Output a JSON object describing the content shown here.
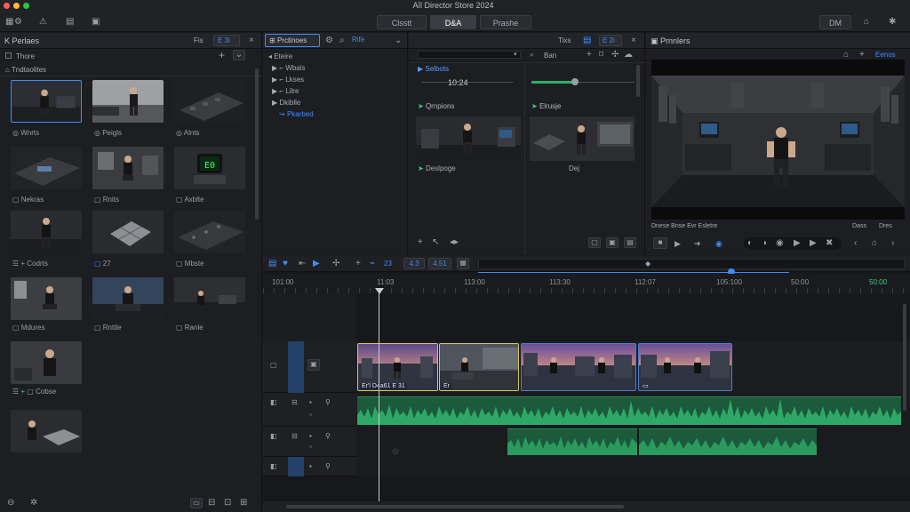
{
  "app": {
    "title": "Aīl Director Store 2024"
  },
  "window_controls": {
    "close_color": "#ff5f57",
    "min_color": "#febc2e",
    "max_color": "#28c840"
  },
  "mode_tabs": [
    {
      "label": "Clsstt"
    },
    {
      "label": "D&A"
    },
    {
      "label": "Prashe"
    }
  ],
  "topbar_right": {
    "button_label": "DM"
  },
  "media_panel": {
    "title": "K Perlaes",
    "header_right": "Fis",
    "header_field": "E 3i",
    "filter_label": "Thore",
    "section_label": "Tndtaolites",
    "thumb_labels": [
      "Wnrts",
      "Peigls",
      "Alnts",
      "Nekras",
      "Rnits",
      "Axblte",
      "Codrts",
      "27",
      "Mbste",
      "Mdures",
      "Rnttle",
      "Ranle",
      "Cobse"
    ]
  },
  "project_panel": {
    "tab_label": "Prctinoes",
    "tab_right": "Rife",
    "tree": [
      {
        "label": "Eteire",
        "expanded": true
      },
      {
        "label": "Wbals"
      },
      {
        "label": "Lkses"
      },
      {
        "label": "Lilre"
      },
      {
        "label": "Dkiblle"
      },
      {
        "label": "Pkarbed",
        "highlight": true
      }
    ]
  },
  "effects_panel": {
    "header_right": "Tixs",
    "header_field": "E 2i",
    "dropdown_label": "Ban",
    "section1_label": "Selbots",
    "value_readout": "10:24",
    "effect_a": "Qrnpions",
    "effect_b": "Elrusje",
    "section2_label": "Deslpoge",
    "caption_b": "Dej"
  },
  "preview_panel": {
    "title": "Prnnlers",
    "header_link": "Eenos",
    "status_left": "Dnese Bnse Evr Esletre",
    "status_right": "Dass",
    "status_far_right": "Dres"
  },
  "timeline": {
    "field_a": "4.3",
    "field_b": "4.51",
    "field_c": "23",
    "ruler": [
      "101:00",
      "11:03",
      "113:00",
      "113:30",
      "112:07",
      "105:100",
      "50:00",
      "50:00"
    ],
    "clip_labels": [
      "Er'l D4a61 E 31",
      "Er"
    ],
    "track_count": 5
  },
  "icons": {
    "close": "close-icon",
    "search": "search-icon",
    "gear": "gear-icon",
    "play": "play-icon"
  }
}
